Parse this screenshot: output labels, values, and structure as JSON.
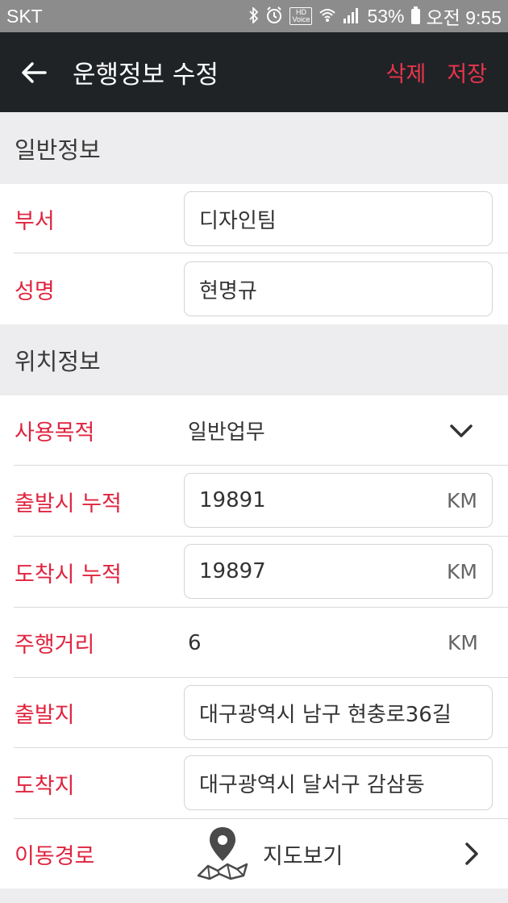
{
  "status_bar": {
    "carrier": "SKT",
    "battery_percent": "53%",
    "time": "오전 9:55",
    "hd_label": "HD",
    "voice_label": "Voice"
  },
  "app_bar": {
    "title": "운행정보 수정",
    "delete_label": "삭제",
    "save_label": "저장",
    "accent_color": "#e8344b"
  },
  "sections": {
    "general": "일반정보",
    "location": "위치정보"
  },
  "general": {
    "department_label": "부서",
    "department_value": "디자인팀",
    "name_label": "성명",
    "name_value": "현명규"
  },
  "location": {
    "purpose_label": "사용목적",
    "purpose_value": "일반업무",
    "start_odo_label": "출발시 누적",
    "start_odo_value": "19891",
    "end_odo_label": "도착시 누적",
    "end_odo_value": "19897",
    "distance_label": "주행거리",
    "distance_value": "6",
    "unit": "KM",
    "origin_label": "출발지",
    "origin_value": "대구광역시 남구 현충로36길",
    "destination_label": "도착지",
    "destination_value": "대구광역시 달서구 감삼동",
    "route_label": "이동경로",
    "map_view_label": "지도보기"
  }
}
